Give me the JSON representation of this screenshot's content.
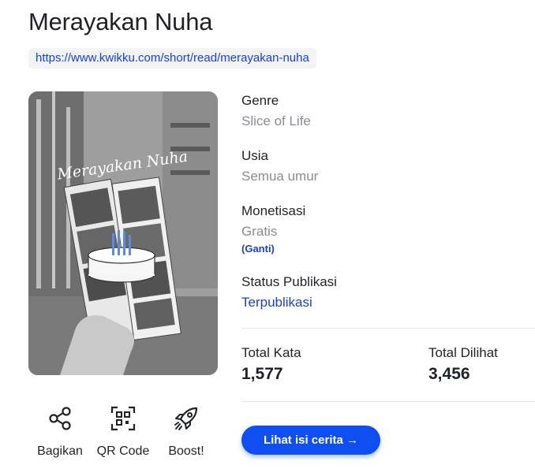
{
  "story": {
    "title": "Merayakan Nuha",
    "url": "https://www.kwikku.com/short/read/merayakan-nuha",
    "cover_title": "Merayakan Nuha"
  },
  "meta": {
    "genre_label": "Genre",
    "genre_value": "Slice of Life",
    "age_label": "Usia",
    "age_value": "Semua umur",
    "monetization_label": "Monetisasi",
    "monetization_value": "Gratis",
    "change_label": "(Ganti)",
    "status_label": "Status Publikasi",
    "status_value": "Terpublikasi"
  },
  "stats": {
    "words_label": "Total Kata",
    "words_value": "1,577",
    "views_label": "Total Dilihat",
    "views_value": "3,456"
  },
  "actions": {
    "share_label": "Bagikan",
    "share_icon": "share-icon",
    "qr_label": "QR Code",
    "qr_icon": "qr-code-icon",
    "boost_label": "Boost!",
    "boost_icon": "rocket-icon"
  },
  "read_button_label": "Lihat isi cerita →",
  "colors": {
    "accent": "#0f4ef0",
    "link": "#1b3fd1",
    "muted": "#8a8d93"
  }
}
